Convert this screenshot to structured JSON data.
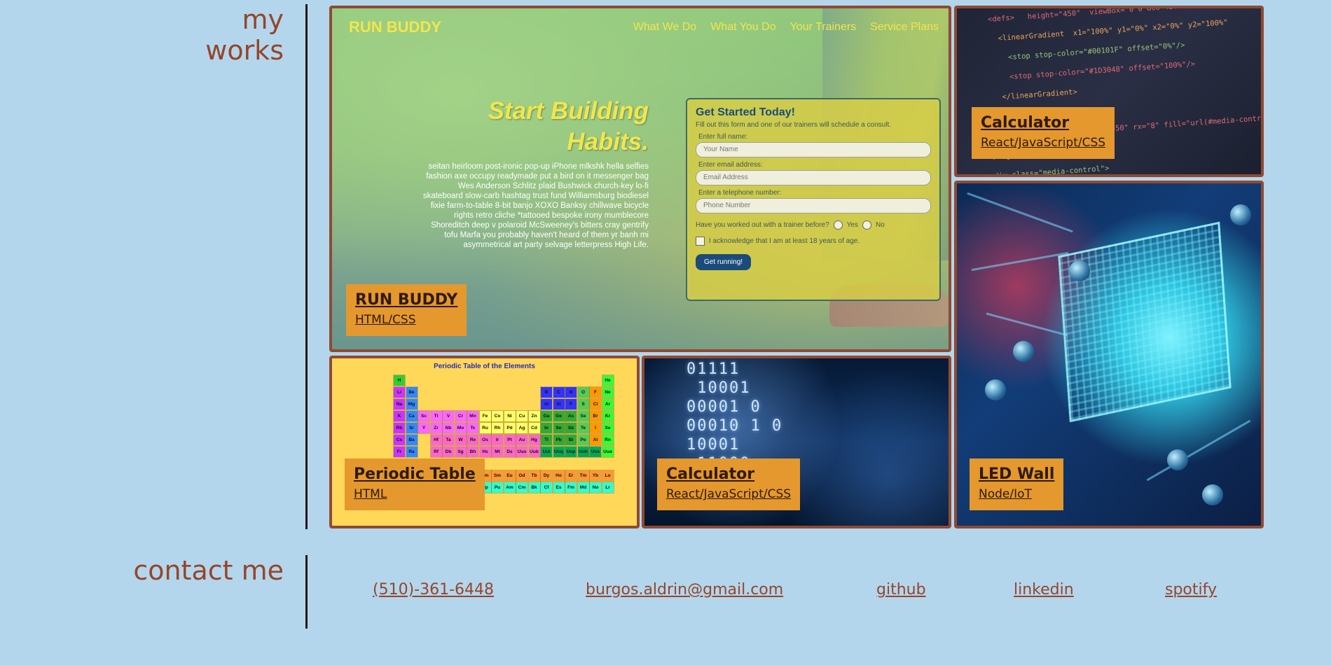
{
  "works_section": {
    "title_line1": "my",
    "title_line2": "works",
    "projects": [
      {
        "id": "runbuddy",
        "title": "RUN BUDDY",
        "tech": "HTML/CSS",
        "preview": {
          "logo": "RUN BUDDY",
          "nav": [
            "What We Do",
            "What You Do",
            "Your Trainers",
            "Service Plans"
          ],
          "hero_title_line1": "Start Building",
          "hero_title_line2": "Habits.",
          "hero_body": "seitan heirloom post-ironic pop-up iPhone mlkshk hella selfies fashion axe occupy readymade put a bird on it messenger bag Wes Anderson Schlitz plaid Bushwick church-key lo-fi skateboard slow-carb hashtag trust fund Williamsburg biodiesel fixie farm-to-table 8-bit banjo XOXO Banksy chillwave bicycle rights retro cliche *tattooed bespoke irony mumblecore Shoreditch deep v polaroid McSweeney's bitters cray gentrify tofu Marfa you probably haven't heard of them yr banh mi asymmetrical art party selvage letterpress High Life.",
          "form_title": "Get Started Today!",
          "form_intro": "Fill out this form and one of our trainers will schedule a consult.",
          "name_label": "Enter full name:",
          "name_placeholder": "Your Name",
          "email_label": "Enter email address:",
          "email_placeholder": "Email Address",
          "phone_label": "Enter a telephone number:",
          "phone_placeholder": "Phone Number",
          "question": "Have you worked out with a trainer before?",
          "yes": "Yes",
          "no": "No",
          "acknowledge": "I acknowledge that I am at least 18 years of age.",
          "submit": "Get running!"
        }
      },
      {
        "id": "calc-code",
        "title": "Calculator",
        "tech": "React/JavaScript/CSS"
      },
      {
        "id": "led",
        "title": "LED Wall",
        "tech": "Node/IoT"
      },
      {
        "id": "periodic",
        "title": "Periodic Table",
        "tech": "HTML",
        "preview": {
          "title": "Periodic Table of the Elements"
        }
      },
      {
        "id": "calc-bin",
        "title": "Calculator",
        "tech": "React/JavaScript/CSS"
      }
    ]
  },
  "contact_section": {
    "title": "contact me",
    "links": [
      {
        "label": "(510)-361-6448"
      },
      {
        "label": "burgos.aldrin@gmail.com"
      },
      {
        "label": "github"
      },
      {
        "label": "linkedin"
      },
      {
        "label": "spotify"
      }
    ]
  },
  "colors": {
    "background": "#b4d6ec",
    "heading": "#94462b",
    "caption_bg": "#e4982e",
    "tile_border": "#8f4a33"
  }
}
